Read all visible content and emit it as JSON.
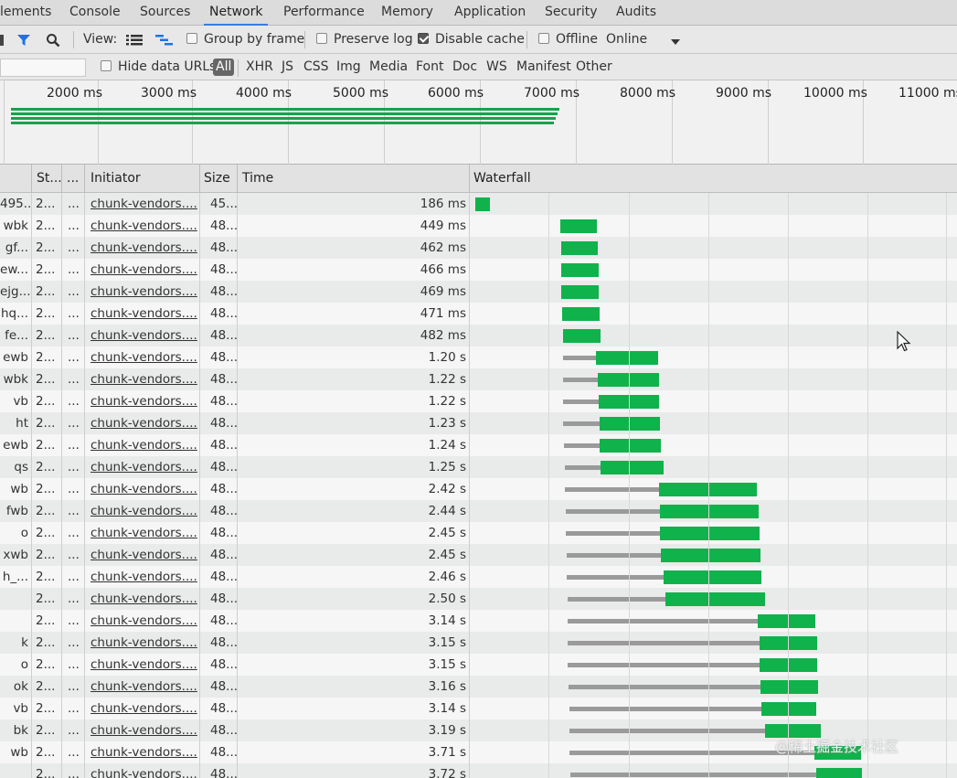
{
  "tabs": [
    "lements",
    "Console",
    "Sources",
    "Network",
    "Performance",
    "Memory",
    "Application",
    "Security",
    "Audits"
  ],
  "toolbar": {
    "view_label": "View:",
    "group_by_frame": "Group by frame",
    "preserve_log": "Preserve log",
    "disable_cache": "Disable cache",
    "offline": "Offline",
    "throttle": "Online",
    "disable_cache_checked": true
  },
  "filter": {
    "hide_data_urls": "Hide data URLs",
    "types": [
      "All",
      "XHR",
      "JS",
      "CSS",
      "Img",
      "Media",
      "Font",
      "Doc",
      "WS",
      "Manifest",
      "Other"
    ],
    "active": "All"
  },
  "overview": {
    "ticks": [
      "2000 ms",
      "3000 ms",
      "4000 ms",
      "5000 ms",
      "6000 ms",
      "7000 ms",
      "8000 ms",
      "9000 ms",
      "10000 ms",
      "11000 ms"
    ]
  },
  "columns": {
    "name": "",
    "status": "St...",
    "type": "...",
    "initiator": "Initiator",
    "size": "Size",
    "time": "Time",
    "waterfall": "Waterfall"
  },
  "requests": [
    {
      "name": "495...",
      "status": "2...",
      "type": "...",
      "initiator": "chunk-vendors....",
      "size": "45...",
      "time": "186 ms"
    },
    {
      "name": "wbk",
      "status": "2...",
      "type": "...",
      "initiator": "chunk-vendors....",
      "size": "48...",
      "time": "449 ms"
    },
    {
      "name": "gf...",
      "status": "2...",
      "type": "...",
      "initiator": "chunk-vendors....",
      "size": "48...",
      "time": "462 ms"
    },
    {
      "name": "ew...",
      "status": "2...",
      "type": "...",
      "initiator": "chunk-vendors....",
      "size": "48...",
      "time": "466 ms"
    },
    {
      "name": "ejg...",
      "status": "2...",
      "type": "...",
      "initiator": "chunk-vendors....",
      "size": "48...",
      "time": "469 ms"
    },
    {
      "name": "hq...",
      "status": "2...",
      "type": "...",
      "initiator": "chunk-vendors....",
      "size": "48...",
      "time": "471 ms"
    },
    {
      "name": "fe...",
      "status": "2...",
      "type": "...",
      "initiator": "chunk-vendors....",
      "size": "48...",
      "time": "482 ms"
    },
    {
      "name": "ewb",
      "status": "2...",
      "type": "...",
      "initiator": "chunk-vendors....",
      "size": "48...",
      "time": "1.20 s"
    },
    {
      "name": "wbk",
      "status": "2...",
      "type": "...",
      "initiator": "chunk-vendors....",
      "size": "48...",
      "time": "1.22 s"
    },
    {
      "name": "vb",
      "status": "2...",
      "type": "...",
      "initiator": "chunk-vendors....",
      "size": "48...",
      "time": "1.22 s"
    },
    {
      "name": "ht",
      "status": "2...",
      "type": "...",
      "initiator": "chunk-vendors....",
      "size": "48...",
      "time": "1.23 s"
    },
    {
      "name": "ewb",
      "status": "2...",
      "type": "...",
      "initiator": "chunk-vendors....",
      "size": "48...",
      "time": "1.24 s"
    },
    {
      "name": "qs",
      "status": "2...",
      "type": "...",
      "initiator": "chunk-vendors....",
      "size": "48...",
      "time": "1.25 s"
    },
    {
      "name": "wb",
      "status": "2...",
      "type": "...",
      "initiator": "chunk-vendors....",
      "size": "48...",
      "time": "2.42 s"
    },
    {
      "name": "fwb",
      "status": "2...",
      "type": "...",
      "initiator": "chunk-vendors....",
      "size": "48...",
      "time": "2.44 s"
    },
    {
      "name": "o",
      "status": "2...",
      "type": "...",
      "initiator": "chunk-vendors....",
      "size": "48...",
      "time": "2.45 s"
    },
    {
      "name": "xwb",
      "status": "2...",
      "type": "...",
      "initiator": "chunk-vendors....",
      "size": "48...",
      "time": "2.45 s"
    },
    {
      "name": "h_...",
      "status": "2...",
      "type": "...",
      "initiator": "chunk-vendors....",
      "size": "48...",
      "time": "2.46 s"
    },
    {
      "name": "",
      "status": "2...",
      "type": "...",
      "initiator": "chunk-vendors....",
      "size": "48...",
      "time": "2.50 s"
    },
    {
      "name": "",
      "status": "2...",
      "type": "...",
      "initiator": "chunk-vendors....",
      "size": "48...",
      "time": "3.14 s"
    },
    {
      "name": "k",
      "status": "2...",
      "type": "...",
      "initiator": "chunk-vendors....",
      "size": "48...",
      "time": "3.15 s"
    },
    {
      "name": "o",
      "status": "2...",
      "type": "...",
      "initiator": "chunk-vendors....",
      "size": "48...",
      "time": "3.15 s"
    },
    {
      "name": "ok",
      "status": "2...",
      "type": "...",
      "initiator": "chunk-vendors....",
      "size": "48...",
      "time": "3.16 s"
    },
    {
      "name": "vb",
      "status": "2...",
      "type": "...",
      "initiator": "chunk-vendors....",
      "size": "48...",
      "time": "3.14 s"
    },
    {
      "name": "bk",
      "status": "2...",
      "type": "...",
      "initiator": "chunk-vendors....",
      "size": "48...",
      "time": "3.19 s"
    },
    {
      "name": "wb",
      "status": "2...",
      "type": "...",
      "initiator": "chunk-vendors....",
      "size": "48...",
      "time": "3.71 s"
    },
    {
      "name": "",
      "status": "2...",
      "type": "...",
      "initiator": "chunk-vendors....",
      "size": "48...",
      "time": "3.72 s"
    }
  ],
  "watermark": "@稀土掘金技术社区",
  "colors": {
    "accent": "#3b7bd9",
    "receiving": "#10b24b",
    "waiting": "#9a9a9a"
  }
}
